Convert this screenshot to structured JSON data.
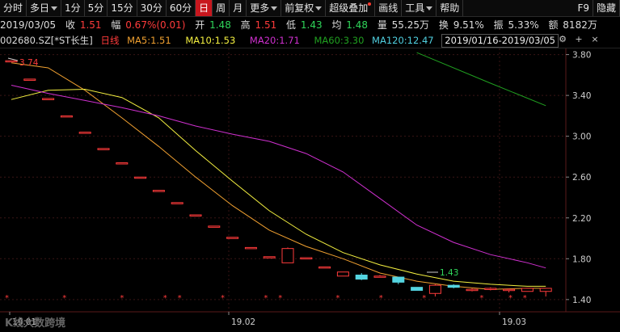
{
  "toolbar": [
    {
      "label": "分时",
      "active": false
    },
    {
      "label": "多日",
      "active": false,
      "caret": true
    },
    {
      "label": "1分",
      "active": false
    },
    {
      "label": "5分",
      "active": false
    },
    {
      "label": "15分",
      "active": false
    },
    {
      "label": "30分",
      "active": false
    },
    {
      "label": "60分",
      "active": false
    },
    {
      "label": "日",
      "active": true
    },
    {
      "label": "周",
      "active": false
    },
    {
      "label": "月",
      "active": false
    },
    {
      "label": "更多",
      "active": false,
      "caret": true
    },
    {
      "label": "前复权",
      "active": false,
      "caret": true
    },
    {
      "label": "超级叠加",
      "active": false,
      "dot": true
    },
    {
      "label": "画线",
      "active": false
    },
    {
      "label": "工具",
      "active": false,
      "caret": true
    },
    {
      "label": "帮助",
      "active": false
    },
    {
      "label": "F9",
      "active": false
    },
    {
      "label": "隐藏",
      "active": false
    }
  ],
  "quote": {
    "date": "2019/03/05",
    "close_label": "收",
    "close": "1.51",
    "change_label": "幅",
    "change": "0.67%(0.01)",
    "open_label": "开",
    "open": "1.48",
    "high_label": "高",
    "high": "1.51",
    "low_label": "低",
    "low": "1.43",
    "avg_label": "均",
    "avg": "1.48",
    "vol_label": "量",
    "vol": "55.25万",
    "turnover_label": "换",
    "turnover": "9.51%",
    "amp_label": "振",
    "amp": "5.33%",
    "amount_label": "额",
    "amount": "8182万"
  },
  "maline": {
    "code": "002680.SZ",
    "name": "[*ST长生]",
    "period": "日线",
    "ma5": "MA5:1.51",
    "ma10": "MA10:1.53",
    "ma20": "MA20:1.71",
    "ma60": "MA60:3.30",
    "ma120": "MA120:12.47",
    "range": "2019/01/16-2019/03/05"
  },
  "colors": {
    "up": "#ff3b3b",
    "down": "#54d4e0",
    "ma5": "#f0a030",
    "ma10": "#f4f040",
    "ma20": "#d030d0",
    "ma60": "#20a020",
    "ma120": "#50d0e0",
    "grid": "#3a1515",
    "brand": "#c8171e"
  },
  "annotations": {
    "max": "3.74",
    "min": "1.43"
  },
  "watermark": "K线大数跨境",
  "axis": {
    "yticks": [
      "3.80",
      "3.40",
      "3.00",
      "2.60",
      "2.20",
      "1.80",
      "1.40"
    ],
    "xticks": [
      "19.01",
      "19.02",
      "19.03"
    ]
  },
  "chart_data": {
    "type": "candlestick",
    "ylim": [
      1.28,
      3.86
    ],
    "candles": [
      {
        "o": 3.74,
        "h": 3.74,
        "l": 3.74,
        "c": 3.74
      },
      {
        "o": 3.56,
        "h": 3.56,
        "l": 3.56,
        "c": 3.56
      },
      {
        "o": 3.37,
        "h": 3.37,
        "l": 3.37,
        "c": 3.37
      },
      {
        "o": 3.2,
        "h": 3.2,
        "l": 3.2,
        "c": 3.2
      },
      {
        "o": 3.04,
        "h": 3.04,
        "l": 3.04,
        "c": 3.04
      },
      {
        "o": 2.88,
        "h": 2.88,
        "l": 2.88,
        "c": 2.88
      },
      {
        "o": 2.74,
        "h": 2.74,
        "l": 2.74,
        "c": 2.74
      },
      {
        "o": 2.6,
        "h": 2.6,
        "l": 2.6,
        "c": 2.6
      },
      {
        "o": 2.47,
        "h": 2.47,
        "l": 2.47,
        "c": 2.47
      },
      {
        "o": 2.35,
        "h": 2.35,
        "l": 2.35,
        "c": 2.35
      },
      {
        "o": 2.23,
        "h": 2.23,
        "l": 2.23,
        "c": 2.23
      },
      {
        "o": 2.12,
        "h": 2.12,
        "l": 2.12,
        "c": 2.12
      },
      {
        "o": 2.01,
        "h": 2.01,
        "l": 2.01,
        "c": 2.01
      },
      {
        "o": 1.91,
        "h": 1.91,
        "l": 1.91,
        "c": 1.91
      },
      {
        "o": 1.82,
        "h": 1.82,
        "l": 1.82,
        "c": 1.82
      },
      {
        "o": 1.76,
        "h": 1.91,
        "l": 1.76,
        "c": 1.9
      },
      {
        "o": 1.81,
        "h": 1.81,
        "l": 1.81,
        "c": 1.81
      },
      {
        "o": 1.72,
        "h": 1.72,
        "l": 1.72,
        "c": 1.72
      },
      {
        "o": 1.63,
        "h": 1.67,
        "l": 1.63,
        "c": 1.67
      },
      {
        "o": 1.64,
        "h": 1.66,
        "l": 1.59,
        "c": 1.6
      },
      {
        "o": 1.63,
        "h": 1.64,
        "l": 1.62,
        "c": 1.63
      },
      {
        "o": 1.62,
        "h": 1.62,
        "l": 1.55,
        "c": 1.57
      },
      {
        "o": 1.52,
        "h": 1.52,
        "l": 1.49,
        "c": 1.49
      },
      {
        "o": 1.46,
        "h": 1.55,
        "l": 1.43,
        "c": 1.54
      },
      {
        "o": 1.54,
        "h": 1.55,
        "l": 1.51,
        "c": 1.52
      },
      {
        "o": 1.49,
        "h": 1.51,
        "l": 1.48,
        "c": 1.5
      },
      {
        "o": 1.5,
        "h": 1.52,
        "l": 1.49,
        "c": 1.51
      },
      {
        "o": 1.49,
        "h": 1.51,
        "l": 1.47,
        "c": 1.5
      },
      {
        "o": 1.48,
        "h": 1.51,
        "l": 1.48,
        "c": 1.51
      },
      {
        "o": 1.48,
        "h": 1.51,
        "l": 1.43,
        "c": 1.51
      }
    ],
    "series": [
      {
        "name": "MA5",
        "color": "#f0a030",
        "values": [
          [
            0,
            3.72
          ],
          [
            2,
            3.67
          ],
          [
            4,
            3.45
          ],
          [
            6,
            3.18
          ],
          [
            8,
            2.9
          ],
          [
            10,
            2.6
          ],
          [
            12,
            2.32
          ],
          [
            14,
            2.08
          ],
          [
            16,
            1.92
          ],
          [
            18,
            1.8
          ],
          [
            20,
            1.66
          ],
          [
            22,
            1.58
          ],
          [
            24,
            1.53
          ],
          [
            26,
            1.5
          ],
          [
            28,
            1.51
          ],
          [
            29,
            1.51
          ]
        ]
      },
      {
        "name": "MA10",
        "color": "#f4f040",
        "values": [
          [
            0,
            3.36
          ],
          [
            2,
            3.45
          ],
          [
            4,
            3.46
          ],
          [
            6,
            3.38
          ],
          [
            8,
            3.18
          ],
          [
            10,
            2.86
          ],
          [
            12,
            2.56
          ],
          [
            14,
            2.27
          ],
          [
            16,
            2.04
          ],
          [
            18,
            1.86
          ],
          [
            20,
            1.74
          ],
          [
            22,
            1.65
          ],
          [
            24,
            1.58
          ],
          [
            26,
            1.55
          ],
          [
            28,
            1.53
          ],
          [
            29,
            1.53
          ]
        ]
      },
      {
        "name": "MA20",
        "color": "#d030d0",
        "values": [
          [
            0,
            3.5
          ],
          [
            2,
            3.42
          ],
          [
            4,
            3.35
          ],
          [
            6,
            3.28
          ],
          [
            8,
            3.2
          ],
          [
            10,
            3.1
          ],
          [
            12,
            3.02
          ],
          [
            14,
            2.95
          ],
          [
            16,
            2.83
          ],
          [
            18,
            2.65
          ],
          [
            20,
            2.39
          ],
          [
            22,
            2.13
          ],
          [
            24,
            1.96
          ],
          [
            26,
            1.84
          ],
          [
            28,
            1.76
          ],
          [
            29,
            1.71
          ]
        ]
      },
      {
        "name": "MA60",
        "color": "#20a020",
        "values": [
          [
            22,
            3.82
          ],
          [
            26,
            3.52
          ],
          [
            29,
            3.3
          ]
        ]
      }
    ],
    "signal_marks": [
      0,
      4,
      8,
      11,
      12,
      15,
      18,
      19,
      23,
      26,
      29,
      33,
      35,
      36
    ]
  }
}
